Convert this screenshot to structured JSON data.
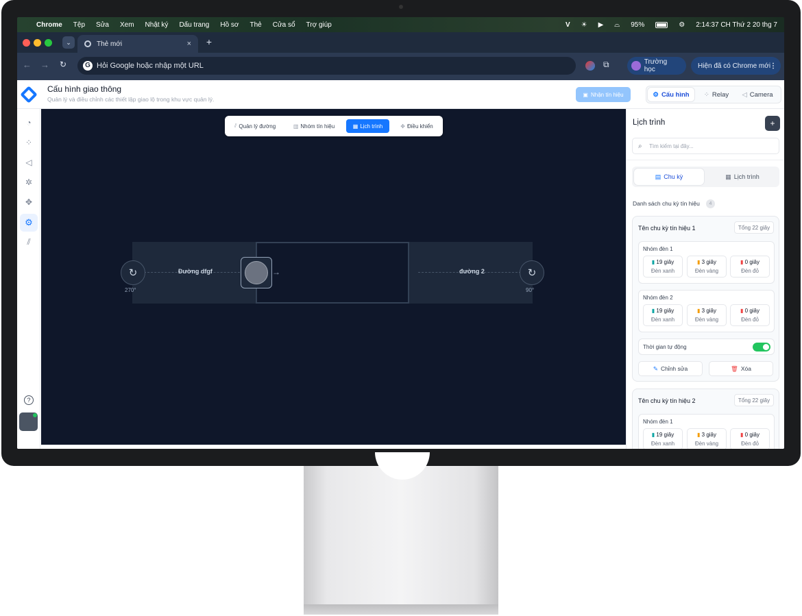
{
  "menubar": {
    "apple": "",
    "items": [
      "Chrome",
      "Tệp",
      "Sửa",
      "Xem",
      "Nhật ký",
      "Dấu trang",
      "Hồ sơ",
      "Thẻ",
      "Cửa sổ",
      "Trợ giúp"
    ],
    "battery": "95%",
    "clock": "2:14:37 CH Thứ 2 20 thg 7"
  },
  "browser": {
    "tab_title": "Thẻ mới",
    "omnibox_placeholder": "Hỏi Google hoặc nhập một URL",
    "profile_label": "Trường học",
    "update_label": "Hiện đã có Chrome mới"
  },
  "app": {
    "title": "Cấu hình giao thông",
    "subtitle": "Quản lý và điều chỉnh các thiết lập giao lộ trong khu vực quản lý.",
    "receive_signal": "Nhận tín hiệu",
    "top_tabs": [
      "Cấu hình",
      "Relay",
      "Camera"
    ],
    "canvas_tabs": [
      "Quản lý đường",
      "Nhóm tín hiệu",
      "Lịch trình",
      "Điều khiển"
    ],
    "road_left": {
      "name": "Đường dfgf",
      "angle": "270°"
    },
    "road_right": {
      "name": "đường 2",
      "angle": "90°"
    }
  },
  "panel": {
    "title": "Lịch trình",
    "search_placeholder": "Tìm kiếm tại đây...",
    "seg_tabs": [
      "Chu kỳ",
      "Lịch trình"
    ],
    "list_title": "Danh sách chu kỳ tín hiệu",
    "list_count": "4",
    "cycles": [
      {
        "name": "Tên chu kỳ tín hiệu 1",
        "total": "Tổng 22 giây",
        "groups": [
          {
            "name": "Nhóm đèn 1",
            "green": "19 giây",
            "yellow": "3 giây",
            "red": "0 giây"
          },
          {
            "name": "Nhóm đèn 2",
            "green": "19 giây",
            "yellow": "3 giây",
            "red": "0 giây"
          }
        ],
        "auto_time": "Thời gian tự động",
        "edit": "Chỉnh sửa",
        "delete": "Xóa"
      },
      {
        "name": "Tên chu kỳ tín hiệu 2",
        "total": "Tổng 22 giây",
        "groups": [
          {
            "name": "Nhóm đèn 1",
            "green": "19 giây",
            "yellow": "3 giây",
            "red": "0 giây"
          }
        ]
      }
    ],
    "lamp_labels": {
      "green": "Đèn xanh",
      "yellow": "Đèn vàng",
      "red": "Đèn đỏ"
    }
  },
  "colors": {
    "accent": "#1677ff",
    "green": "#0ea5a4",
    "yellow": "#f59e0b",
    "red": "#ef4444",
    "toggle": "#22c55e"
  }
}
